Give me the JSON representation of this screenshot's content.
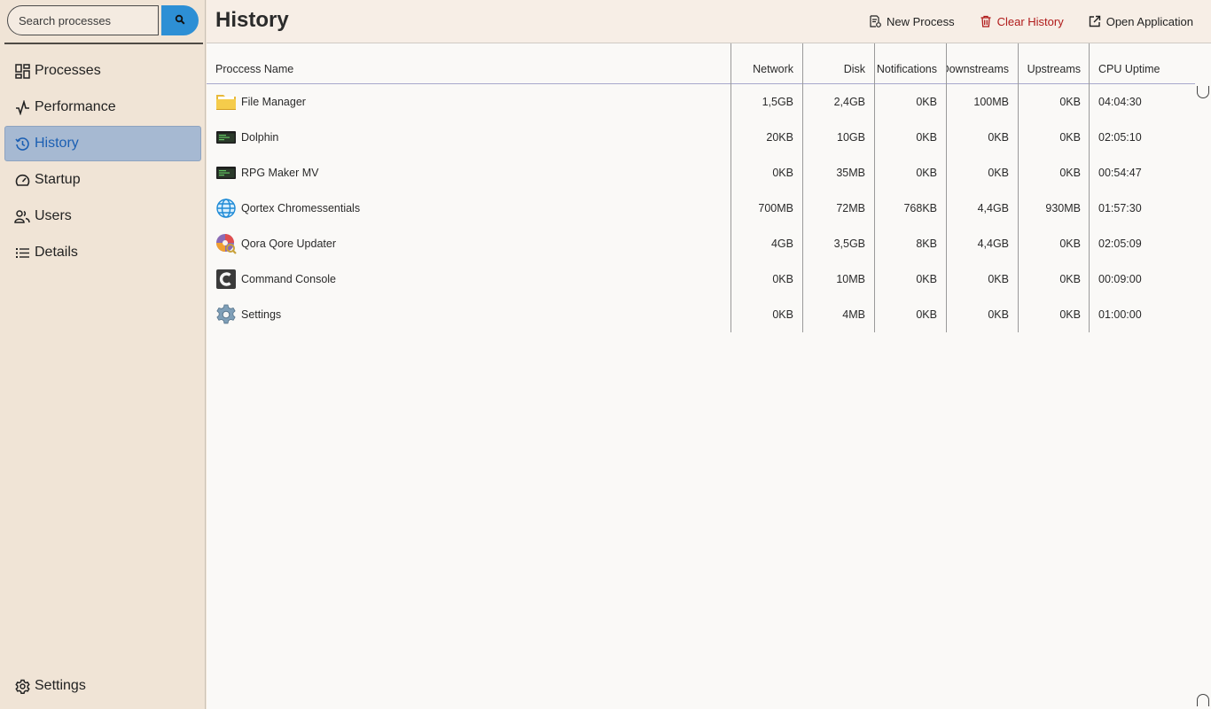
{
  "search": {
    "placeholder": "Search processes"
  },
  "sidebar": {
    "items": [
      {
        "label": "Processes",
        "icon": "dashboard-icon"
      },
      {
        "label": "Performance",
        "icon": "activity-icon"
      },
      {
        "label": "History",
        "icon": "history-icon",
        "active": true
      },
      {
        "label": "Startup",
        "icon": "gauge-icon"
      },
      {
        "label": "Users",
        "icon": "users-icon"
      },
      {
        "label": "Details",
        "icon": "list-icon"
      }
    ],
    "settings_label": "Settings"
  },
  "header": {
    "title": "History",
    "actions": [
      {
        "label": "New Process",
        "icon": "new-process-icon"
      },
      {
        "label": "Clear History",
        "icon": "trash-icon",
        "color": "#b01a1a"
      },
      {
        "label": "Open Application",
        "icon": "external-link-icon"
      }
    ]
  },
  "table": {
    "columns": [
      "Proccess Name",
      "Network",
      "Disk",
      "Notifications",
      "Downstreams",
      "Upstreams",
      "CPU Uptime"
    ],
    "rows": [
      {
        "name": "File Manager",
        "icon": "folder-icon",
        "network": "1,5GB",
        "disk": "2,4GB",
        "notifications": "0KB",
        "downstreams": "100MB",
        "upstreams": "0KB",
        "uptime": "04:04:30"
      },
      {
        "name": "Dolphin",
        "icon": "terminal-window-icon",
        "network": "20KB",
        "disk": "10GB",
        "notifications": "0KB",
        "downstreams": "0KB",
        "upstreams": "0KB",
        "uptime": "02:05:10"
      },
      {
        "name": "RPG Maker MV",
        "icon": "terminal-window-icon",
        "network": "0KB",
        "disk": "35MB",
        "notifications": "0KB",
        "downstreams": "0KB",
        "upstreams": "0KB",
        "uptime": "00:54:47"
      },
      {
        "name": "Qortex Chromessentials",
        "icon": "globe-icon",
        "network": "700MB",
        "disk": "72MB",
        "notifications": "768KB",
        "downstreams": "4,4GB",
        "upstreams": "930MB",
        "uptime": "01:57:30"
      },
      {
        "name": "Qora Qore Updater",
        "icon": "disc-updater-icon",
        "network": "4GB",
        "disk": "3,5GB",
        "notifications": "8KB",
        "downstreams": "4,4GB",
        "upstreams": "0KB",
        "uptime": "02:05:09"
      },
      {
        "name": "Command Console",
        "icon": "console-c-icon",
        "network": "0KB",
        "disk": "10MB",
        "notifications": "0KB",
        "downstreams": "0KB",
        "upstreams": "0KB",
        "uptime": "00:09:00"
      },
      {
        "name": "Settings",
        "icon": "gear-icon",
        "network": "0KB",
        "disk": "4MB",
        "notifications": "0KB",
        "downstreams": "0KB",
        "upstreams": "0KB",
        "uptime": "01:00:00"
      }
    ]
  }
}
